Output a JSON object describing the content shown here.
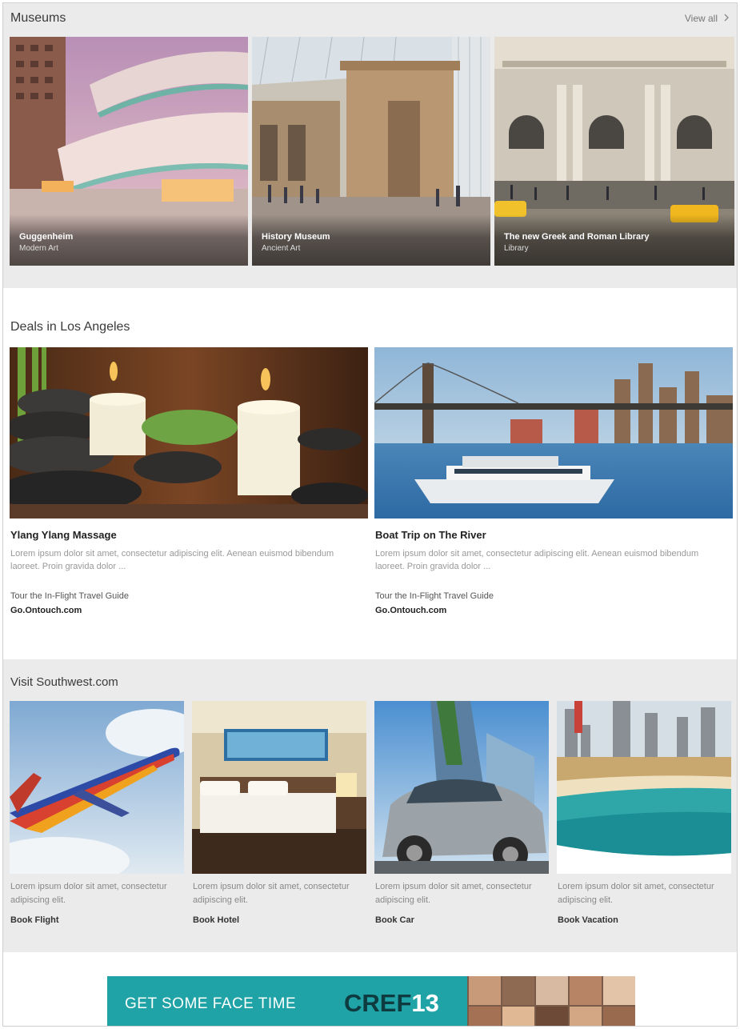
{
  "museums": {
    "title": "Museums",
    "view_all": "View all",
    "items": [
      {
        "title": "Guggenheim",
        "subtitle": "Modern Art"
      },
      {
        "title": "History Museum",
        "subtitle": "Ancient Art"
      },
      {
        "title": "The new Greek and Roman Library",
        "subtitle": "Library"
      }
    ]
  },
  "deals": {
    "title": "Deals in Los Angeles",
    "items": [
      {
        "title": "Ylang Ylang Massage",
        "description": "Lorem ipsum dolor sit amet, consectetur adipiscing elit. Aenean euismod bibendum laoreet. Proin gravida dolor ...",
        "link_text": "Tour the In-Flight Travel Guide",
        "link_url": "Go.Ontouch.com"
      },
      {
        "title": "Boat Trip on The River",
        "description": "Lorem ipsum dolor sit amet, consectetur adipiscing elit. Aenean euismod bibendum laoreet. Proin gravida dolor ...",
        "link_text": "Tour the In-Flight Travel Guide",
        "link_url": "Go.Ontouch.com"
      }
    ]
  },
  "southwest": {
    "title": "Visit Southwest.com",
    "items": [
      {
        "description": "Lorem ipsum dolor sit amet, consectetur adipiscing elit.",
        "link": "Book Flight"
      },
      {
        "description": "Lorem ipsum dolor sit amet, consectetur adipiscing elit.",
        "link": "Book Hotel"
      },
      {
        "description": "Lorem ipsum dolor sit amet, consectetur adipiscing elit.",
        "link": "Book Car"
      },
      {
        "description": "Lorem ipsum dolor sit amet, consectetur adipiscing elit.",
        "link": "Book Vacation"
      }
    ]
  },
  "ad": {
    "tagline": "GET SOME FACE TIME",
    "brand": "CREF",
    "brand_number": "13"
  },
  "colors": {
    "section_gray": "#ebebeb",
    "ad_teal": "#1fa3a6",
    "ad_dark": "#0e3b3f"
  }
}
